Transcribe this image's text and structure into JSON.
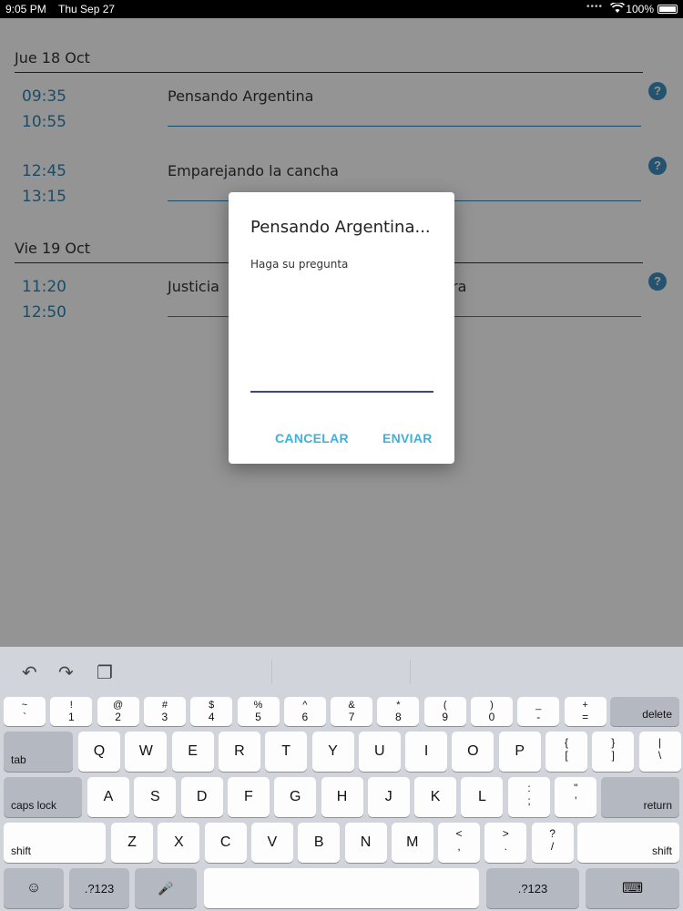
{
  "status_bar": {
    "time": "9:05 PM",
    "date": "Thu Sep 27",
    "battery": "100%"
  },
  "agenda": {
    "days": [
      {
        "label": "Jue 18 Oct",
        "sessions": [
          {
            "start": "09:35",
            "end": "10:55",
            "title": "Pensando Argentina"
          },
          {
            "start": "12:45",
            "end": "13:15",
            "title": "Emparejando la cancha"
          }
        ]
      },
      {
        "label": "Vie 19 Oct",
        "sessions": [
          {
            "start": "11:20",
            "end": "12:50",
            "title": "Justicia"
          }
        ]
      }
    ],
    "partial_text": "ra"
  },
  "dialog": {
    "title": "Pensando Argentina...",
    "label": "Haga su pregunta",
    "input_value": "",
    "cancel": "CANCELAR",
    "send": "ENVIAR"
  },
  "keyboard": {
    "number_row": [
      {
        "top": "~",
        "bot": "`"
      },
      {
        "top": "!",
        "bot": "1"
      },
      {
        "top": "@",
        "bot": "2"
      },
      {
        "top": "#",
        "bot": "3"
      },
      {
        "top": "$",
        "bot": "4"
      },
      {
        "top": "%",
        "bot": "5"
      },
      {
        "top": "^",
        "bot": "6"
      },
      {
        "top": "&",
        "bot": "7"
      },
      {
        "top": "*",
        "bot": "8"
      },
      {
        "top": "(",
        "bot": "9"
      },
      {
        "top": ")",
        "bot": "0"
      },
      {
        "top": "_",
        "bot": "-"
      },
      {
        "top": "+",
        "bot": "="
      }
    ],
    "delete": "delete",
    "tab": "tab",
    "row1": [
      "Q",
      "W",
      "E",
      "R",
      "T",
      "Y",
      "U",
      "I",
      "O",
      "P"
    ],
    "row1_symbols": [
      {
        "top": "{",
        "bot": "["
      },
      {
        "top": "}",
        "bot": "]"
      },
      {
        "top": "|",
        "bot": "\\"
      }
    ],
    "caps_lock": "caps lock",
    "row2": [
      "A",
      "S",
      "D",
      "F",
      "G",
      "H",
      "J",
      "K",
      "L"
    ],
    "row2_symbols": [
      {
        "top": ":",
        "bot": ";"
      },
      {
        "top": "\"",
        "bot": "'"
      }
    ],
    "return": "return",
    "shift": "shift",
    "row3": [
      "Z",
      "X",
      "C",
      "V",
      "B",
      "N",
      "M"
    ],
    "row3_symbols": [
      {
        "top": "<",
        "bot": ","
      },
      {
        "top": ">",
        "bot": "."
      },
      {
        "top": "?",
        "bot": "/"
      }
    ],
    "numbers": ".?123"
  },
  "icons": {
    "question": "?",
    "undo": "↶",
    "redo": "↷",
    "paste": "❐",
    "emoji": "☺",
    "mic": "🎤",
    "hide_keyboard": "⌨"
  }
}
